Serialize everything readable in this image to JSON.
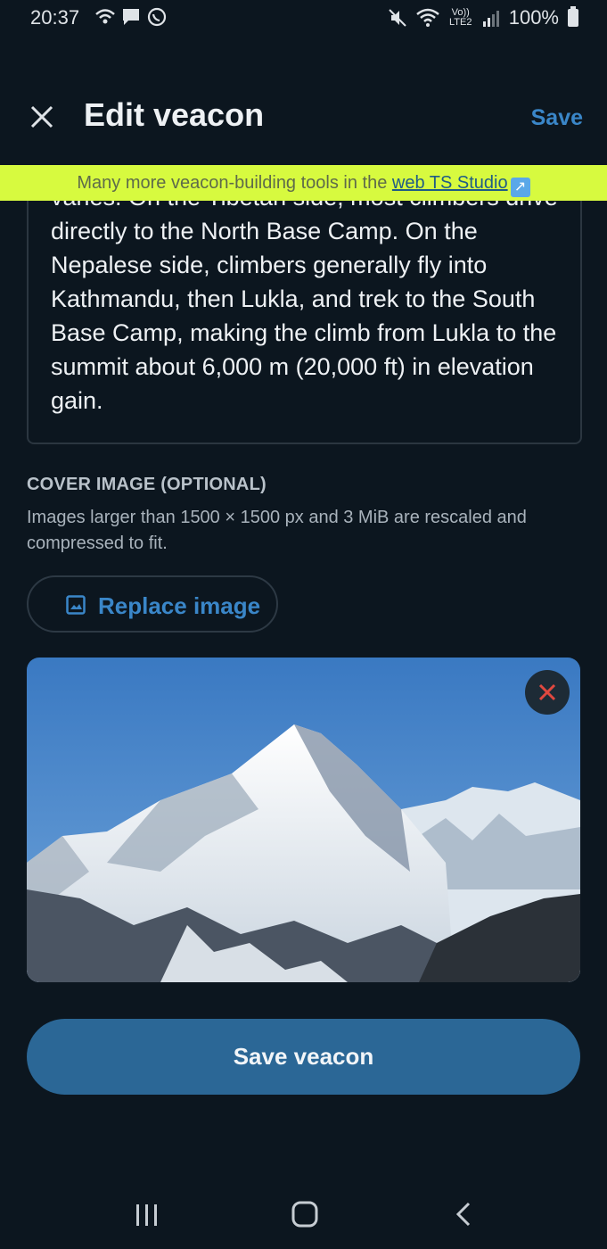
{
  "status_bar": {
    "time": "20:37",
    "left_icons": [
      "wifi-calling-icon",
      "message-icon",
      "whatsapp-icon"
    ],
    "right_icons": [
      "mute-icon",
      "wifi-icon",
      "volte-icon",
      "signal-icon"
    ],
    "network_label": "Vo)) LTE2",
    "battery": "100%"
  },
  "header": {
    "close_icon": "close-icon",
    "title": "Edit veacon",
    "save_label": "Save"
  },
  "banner": {
    "text": "Many more veacon-building tools in the ",
    "link_text": "web TS Studio",
    "link_icon": "external-link-icon",
    "background": "#d7fa3f"
  },
  "description": {
    "text": "varies. On the Tibetan side, most climbers drive directly to the North Base Camp. On the Nepalese side, climbers generally fly into Kathmandu, then Lukla, and trek to the South Base Camp, making the climb from Lukla to the summit about 6,000 m (20,000 ft) in elevation gain."
  },
  "cover_image": {
    "label": "COVER IMAGE (OPTIONAL)",
    "help": "Images larger than 1500 × 1500 px and 3 MiB are rescaled and compressed to fit.",
    "replace_label": "Replace image",
    "replace_icon": "image-icon",
    "remove_icon": "close-icon",
    "image_subject": "snow-covered mountain peak under blue sky"
  },
  "save_button": {
    "label": "Save veacon"
  },
  "nav_bar": {
    "icons": [
      "recent-apps-icon",
      "home-icon",
      "back-icon"
    ]
  },
  "colors": {
    "background": "#0c161f",
    "accent": "#3a86c8",
    "primary_button": "#2b6796",
    "remove": "#e0483f"
  }
}
